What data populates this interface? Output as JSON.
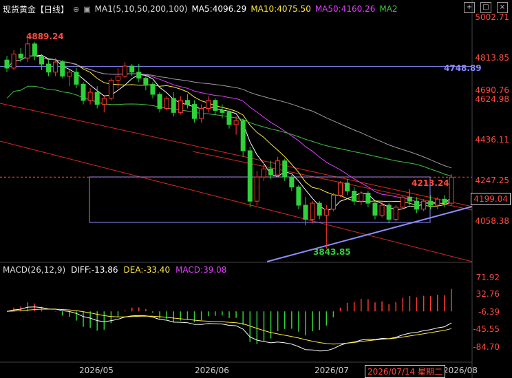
{
  "header": {
    "title": "现货黄金【日线】",
    "ma_label": "MA1(5,10,50,200,100)",
    "ma5": "MA5:4096.29",
    "ma10": "MA10:4075.50",
    "ma50": "MA50:4160.26",
    "ma2": "MA2"
  },
  "macd_header": {
    "label": "MACD(26,12,9)",
    "diff": "DIFF:-13.86",
    "dea": "DEA:-33.40",
    "macd": "MACD:39.08"
  },
  "price_axis": [
    "5002.71",
    "4813.85",
    "4690.76",
    "4624.98",
    "4436.11",
    "4247.25",
    "4058.38"
  ],
  "current_price": "4199.04",
  "macd_axis": [
    "71.92",
    "32.76",
    "-6.39",
    "-45.55",
    "-84.70"
  ],
  "x_axis": [
    "2026/05",
    "2026/06",
    "2026/07",
    "2026/08"
  ],
  "hover_date": "2026/07/14 星期二",
  "annotations": {
    "high": "4889.24",
    "level": "4748.89",
    "recent": "4213.24",
    "low": "3843.85"
  },
  "colors": {
    "up": "#ff3b30",
    "down": "#2fd23a",
    "ma5": "#ffffff",
    "ma10": "#ffeb3b",
    "ma50": "#e040fb",
    "ma100": "#9e9e9e",
    "ma200": "#3ec43e",
    "diff": "#ffffff",
    "dea": "#ffeb3b"
  },
  "chart_data": {
    "type": "candlestick",
    "title": "现货黄金【日线】",
    "ylim": [
      3780,
      5002.71
    ],
    "candles_ohlc": [
      [
        4780,
        4800,
        4720,
        4740
      ],
      [
        4740,
        4830,
        4730,
        4810
      ],
      [
        4810,
        4840,
        4770,
        4790
      ],
      [
        4790,
        4889.24,
        4770,
        4860
      ],
      [
        4860,
        4870,
        4780,
        4800
      ],
      [
        4800,
        4810,
        4730,
        4760
      ],
      [
        4760,
        4780,
        4700,
        4720
      ],
      [
        4720,
        4790,
        4700,
        4770
      ],
      [
        4770,
        4780,
        4690,
        4700
      ],
      [
        4700,
        4730,
        4650,
        4720
      ],
      [
        4720,
        4740,
        4640,
        4660
      ],
      [
        4660,
        4670,
        4560,
        4580
      ],
      [
        4580,
        4640,
        4560,
        4620
      ],
      [
        4620,
        4650,
        4540,
        4560
      ],
      [
        4560,
        4600,
        4520,
        4590
      ],
      [
        4590,
        4690,
        4580,
        4680
      ],
      [
        4680,
        4740,
        4640,
        4700
      ],
      [
        4700,
        4770,
        4690,
        4750
      ],
      [
        4750,
        4760,
        4700,
        4720
      ],
      [
        4720,
        4760,
        4670,
        4690
      ],
      [
        4690,
        4700,
        4630,
        4660
      ],
      [
        4660,
        4670,
        4590,
        4610
      ],
      [
        4610,
        4620,
        4520,
        4540
      ],
      [
        4540,
        4600,
        4530,
        4590
      ],
      [
        4590,
        4620,
        4500,
        4520
      ],
      [
        4520,
        4600,
        4510,
        4580
      ],
      [
        4580,
        4610,
        4540,
        4560
      ],
      [
        4560,
        4580,
        4470,
        4490
      ],
      [
        4490,
        4560,
        4470,
        4540
      ],
      [
        4540,
        4600,
        4520,
        4580
      ],
      [
        4580,
        4590,
        4510,
        4530
      ],
      [
        4530,
        4560,
        4490,
        4520
      ],
      [
        4520,
        4530,
        4440,
        4460
      ],
      [
        4460,
        4500,
        4410,
        4480
      ],
      [
        4480,
        4490,
        4300,
        4330
      ],
      [
        4330,
        4350,
        4050,
        4080
      ],
      [
        4080,
        4230,
        4060,
        4200
      ],
      [
        4200,
        4270,
        4180,
        4240
      ],
      [
        4240,
        4280,
        4190,
        4210
      ],
      [
        4210,
        4300,
        4200,
        4280
      ],
      [
        4280,
        4290,
        4180,
        4200
      ],
      [
        4200,
        4210,
        4130,
        4150
      ],
      [
        4150,
        4160,
        4040,
        4060
      ],
      [
        4060,
        4100,
        3960,
        3990
      ],
      [
        3990,
        4080,
        3970,
        4070
      ],
      [
        4070,
        4080,
        3990,
        4010
      ],
      [
        4010,
        4060,
        3843.85,
        4040
      ],
      [
        4040,
        4120,
        4030,
        4110
      ],
      [
        4110,
        4180,
        4100,
        4170
      ],
      [
        4170,
        4190,
        4110,
        4130
      ],
      [
        4130,
        4150,
        4060,
        4080
      ],
      [
        4080,
        4130,
        4060,
        4120
      ],
      [
        4120,
        4130,
        4050,
        4070
      ],
      [
        4070,
        4080,
        3990,
        4010
      ],
      [
        4010,
        4080,
        4000,
        4060
      ],
      [
        4060,
        4070,
        3970,
        3990
      ],
      [
        3990,
        4060,
        3980,
        4050
      ],
      [
        4050,
        4110,
        4040,
        4100
      ],
      [
        4100,
        4140,
        4060,
        4080
      ],
      [
        4080,
        4100,
        4020,
        4040
      ],
      [
        4040,
        4090,
        4030,
        4080
      ],
      [
        4080,
        4110,
        4040,
        4060
      ],
      [
        4060,
        4100,
        4040,
        4090
      ],
      [
        4090,
        4110,
        4050,
        4070
      ],
      [
        4070,
        4213.24,
        4060,
        4199.04
      ]
    ],
    "ma_values": {
      "MA5": 4096.29,
      "MA10": 4075.5,
      "MA50": 4160.26
    },
    "horizontal_level": 4748.89,
    "current_price": 4199.04,
    "macd": {
      "diff": -13.86,
      "dea": -33.4,
      "macd": 39.08,
      "ylim": [
        -100,
        80
      ]
    }
  }
}
